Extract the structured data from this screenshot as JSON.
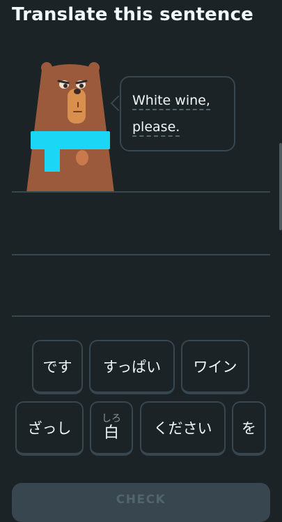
{
  "header": {
    "title": "Translate this sentence"
  },
  "prompt": {
    "line1": "White wine,",
    "line2": "please."
  },
  "word_bank": {
    "row1": [
      {
        "label": "です"
      },
      {
        "label": "すっぱい"
      },
      {
        "label": "ワイン"
      }
    ],
    "row2": [
      {
        "label": "ざっし"
      },
      {
        "label": "白",
        "reading": "しろ"
      },
      {
        "label": "ください"
      },
      {
        "label": "を"
      }
    ]
  },
  "footer": {
    "check_label": "CHECK"
  },
  "colors": {
    "background": "#1b2327",
    "border": "#37464f",
    "text": "#f1f7fa",
    "bear_fur": "#9b5a3c",
    "bear_muzzle": "#d9904e",
    "scarf": "#1cd6f5"
  },
  "icons": {
    "character": "bear-character-illustration"
  }
}
